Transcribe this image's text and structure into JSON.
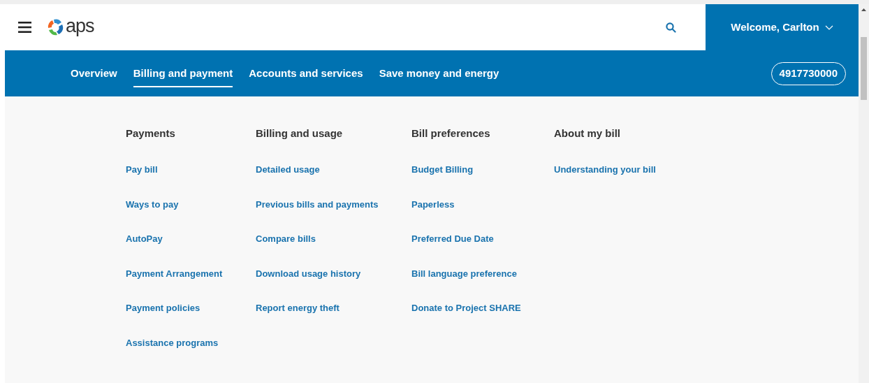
{
  "header": {
    "logo": "aps",
    "user_menu": "Welcome, Carlton"
  },
  "nav": {
    "tabs": [
      {
        "label": "Overview",
        "selected": false
      },
      {
        "label": "Billing and payment",
        "selected": true
      },
      {
        "label": "Accounts and services",
        "selected": false
      },
      {
        "label": "Save money and energy",
        "selected": false
      }
    ],
    "account_number": "4917730000"
  },
  "menu_columns": [
    {
      "heading": "Payments",
      "links": [
        "Pay bill",
        "Ways to pay",
        "AutoPay",
        "Payment Arrangement",
        "Payment policies",
        "Assistance programs"
      ]
    },
    {
      "heading": "Billing and usage",
      "links": [
        "Detailed usage",
        "Previous bills and payments",
        "Compare bills",
        "Download usage history",
        "Report energy theft"
      ]
    },
    {
      "heading": "Bill preferences",
      "links": [
        "Budget Billing",
        "Paperless",
        "Preferred Due Date",
        "Bill language preference",
        "Donate to Project SHARE"
      ]
    },
    {
      "heading": "About my bill",
      "links": [
        "Understanding your bill"
      ]
    }
  ]
}
